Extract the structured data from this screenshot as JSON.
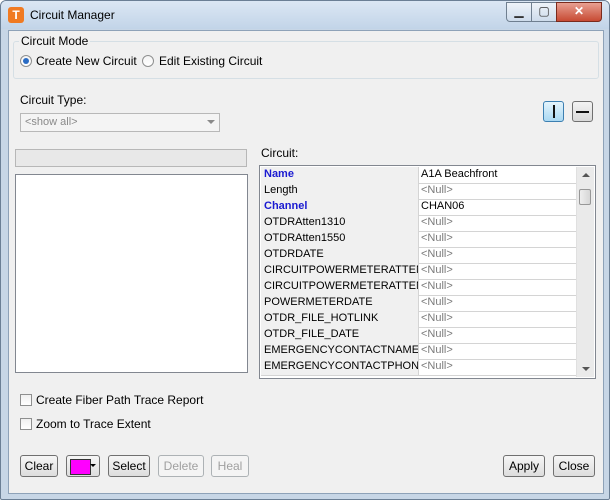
{
  "window": {
    "title": "Circuit Manager",
    "icon_letter": "T",
    "min_glyph": "▁",
    "max_glyph": "▢",
    "close_glyph": "✕"
  },
  "circuit_mode": {
    "legend": "Circuit Mode",
    "options": [
      {
        "label": "Create New Circuit",
        "checked": true
      },
      {
        "label": "Edit Existing Circuit",
        "checked": false
      }
    ]
  },
  "circuit_type": {
    "label": "Circuit Type:",
    "value": "<show all>"
  },
  "circuit_label": "Circuit:",
  "properties": [
    {
      "name": "Name",
      "value": "A1A Beachfront",
      "required": true,
      "null": false
    },
    {
      "name": "Length",
      "value": "<Null>",
      "required": false,
      "null": true
    },
    {
      "name": "Channel",
      "value": "CHAN06",
      "required": true,
      "null": false
    },
    {
      "name": "OTDRAtten1310",
      "value": "<Null>",
      "required": false,
      "null": true
    },
    {
      "name": "OTDRAtten1550",
      "value": "<Null>",
      "required": false,
      "null": true
    },
    {
      "name": "OTDRDATE",
      "value": "<Null>",
      "required": false,
      "null": true
    },
    {
      "name": "CIRCUITPOWERMETERATTEN",
      "value": "<Null>",
      "required": false,
      "null": true
    },
    {
      "name": "CIRCUITPOWERMETERATTEN",
      "value": "<Null>",
      "required": false,
      "null": true
    },
    {
      "name": "POWERMETERDATE",
      "value": "<Null>",
      "required": false,
      "null": true
    },
    {
      "name": "OTDR_FILE_HOTLINK",
      "value": "<Null>",
      "required": false,
      "null": true
    },
    {
      "name": "OTDR_FILE_DATE",
      "value": "<Null>",
      "required": false,
      "null": true
    },
    {
      "name": "EMERGENCYCONTACTNAME",
      "value": "<Null>",
      "required": false,
      "null": true
    },
    {
      "name": "EMERGENCYCONTACTPHONE",
      "value": "<Null>",
      "required": false,
      "null": true
    }
  ],
  "options": {
    "trace_report": {
      "label": "Create Fiber Path Trace Report",
      "checked": false
    },
    "zoom_extent": {
      "label": "Zoom to Trace Extent",
      "checked": false
    }
  },
  "buttons": {
    "clear": "Clear",
    "select": "Select",
    "delete": "Delete",
    "heal": "Heal",
    "apply": "Apply",
    "close": "Close"
  },
  "colors": {
    "trace_color": "#ff00ff",
    "accent": "#2a6cc4",
    "required_field": "#1a1ad1"
  }
}
